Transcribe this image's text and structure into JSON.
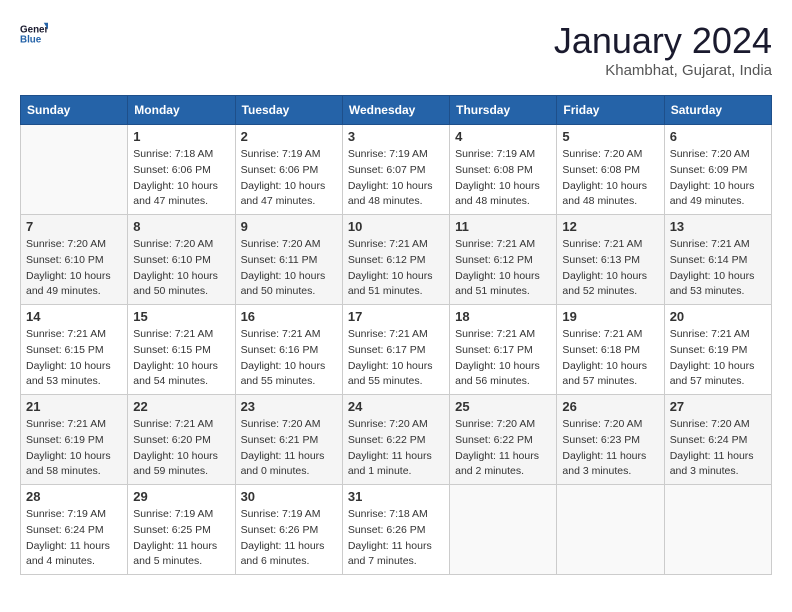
{
  "header": {
    "logo_line1": "General",
    "logo_line2": "Blue",
    "month": "January 2024",
    "location": "Khambhat, Gujarat, India"
  },
  "weekdays": [
    "Sunday",
    "Monday",
    "Tuesday",
    "Wednesday",
    "Thursday",
    "Friday",
    "Saturday"
  ],
  "weeks": [
    [
      {
        "day": "",
        "info": ""
      },
      {
        "day": "1",
        "info": "Sunrise: 7:18 AM\nSunset: 6:06 PM\nDaylight: 10 hours\nand 47 minutes."
      },
      {
        "day": "2",
        "info": "Sunrise: 7:19 AM\nSunset: 6:06 PM\nDaylight: 10 hours\nand 47 minutes."
      },
      {
        "day": "3",
        "info": "Sunrise: 7:19 AM\nSunset: 6:07 PM\nDaylight: 10 hours\nand 48 minutes."
      },
      {
        "day": "4",
        "info": "Sunrise: 7:19 AM\nSunset: 6:08 PM\nDaylight: 10 hours\nand 48 minutes."
      },
      {
        "day": "5",
        "info": "Sunrise: 7:20 AM\nSunset: 6:08 PM\nDaylight: 10 hours\nand 48 minutes."
      },
      {
        "day": "6",
        "info": "Sunrise: 7:20 AM\nSunset: 6:09 PM\nDaylight: 10 hours\nand 49 minutes."
      }
    ],
    [
      {
        "day": "7",
        "info": "Sunrise: 7:20 AM\nSunset: 6:10 PM\nDaylight: 10 hours\nand 49 minutes."
      },
      {
        "day": "8",
        "info": "Sunrise: 7:20 AM\nSunset: 6:10 PM\nDaylight: 10 hours\nand 50 minutes."
      },
      {
        "day": "9",
        "info": "Sunrise: 7:20 AM\nSunset: 6:11 PM\nDaylight: 10 hours\nand 50 minutes."
      },
      {
        "day": "10",
        "info": "Sunrise: 7:21 AM\nSunset: 6:12 PM\nDaylight: 10 hours\nand 51 minutes."
      },
      {
        "day": "11",
        "info": "Sunrise: 7:21 AM\nSunset: 6:12 PM\nDaylight: 10 hours\nand 51 minutes."
      },
      {
        "day": "12",
        "info": "Sunrise: 7:21 AM\nSunset: 6:13 PM\nDaylight: 10 hours\nand 52 minutes."
      },
      {
        "day": "13",
        "info": "Sunrise: 7:21 AM\nSunset: 6:14 PM\nDaylight: 10 hours\nand 53 minutes."
      }
    ],
    [
      {
        "day": "14",
        "info": "Sunrise: 7:21 AM\nSunset: 6:15 PM\nDaylight: 10 hours\nand 53 minutes."
      },
      {
        "day": "15",
        "info": "Sunrise: 7:21 AM\nSunset: 6:15 PM\nDaylight: 10 hours\nand 54 minutes."
      },
      {
        "day": "16",
        "info": "Sunrise: 7:21 AM\nSunset: 6:16 PM\nDaylight: 10 hours\nand 55 minutes."
      },
      {
        "day": "17",
        "info": "Sunrise: 7:21 AM\nSunset: 6:17 PM\nDaylight: 10 hours\nand 55 minutes."
      },
      {
        "day": "18",
        "info": "Sunrise: 7:21 AM\nSunset: 6:17 PM\nDaylight: 10 hours\nand 56 minutes."
      },
      {
        "day": "19",
        "info": "Sunrise: 7:21 AM\nSunset: 6:18 PM\nDaylight: 10 hours\nand 57 minutes."
      },
      {
        "day": "20",
        "info": "Sunrise: 7:21 AM\nSunset: 6:19 PM\nDaylight: 10 hours\nand 57 minutes."
      }
    ],
    [
      {
        "day": "21",
        "info": "Sunrise: 7:21 AM\nSunset: 6:19 PM\nDaylight: 10 hours\nand 58 minutes."
      },
      {
        "day": "22",
        "info": "Sunrise: 7:21 AM\nSunset: 6:20 PM\nDaylight: 10 hours\nand 59 minutes."
      },
      {
        "day": "23",
        "info": "Sunrise: 7:20 AM\nSunset: 6:21 PM\nDaylight: 11 hours\nand 0 minutes."
      },
      {
        "day": "24",
        "info": "Sunrise: 7:20 AM\nSunset: 6:22 PM\nDaylight: 11 hours\nand 1 minute."
      },
      {
        "day": "25",
        "info": "Sunrise: 7:20 AM\nSunset: 6:22 PM\nDaylight: 11 hours\nand 2 minutes."
      },
      {
        "day": "26",
        "info": "Sunrise: 7:20 AM\nSunset: 6:23 PM\nDaylight: 11 hours\nand 3 minutes."
      },
      {
        "day": "27",
        "info": "Sunrise: 7:20 AM\nSunset: 6:24 PM\nDaylight: 11 hours\nand 3 minutes."
      }
    ],
    [
      {
        "day": "28",
        "info": "Sunrise: 7:19 AM\nSunset: 6:24 PM\nDaylight: 11 hours\nand 4 minutes."
      },
      {
        "day": "29",
        "info": "Sunrise: 7:19 AM\nSunset: 6:25 PM\nDaylight: 11 hours\nand 5 minutes."
      },
      {
        "day": "30",
        "info": "Sunrise: 7:19 AM\nSunset: 6:26 PM\nDaylight: 11 hours\nand 6 minutes."
      },
      {
        "day": "31",
        "info": "Sunrise: 7:18 AM\nSunset: 6:26 PM\nDaylight: 11 hours\nand 7 minutes."
      },
      {
        "day": "",
        "info": ""
      },
      {
        "day": "",
        "info": ""
      },
      {
        "day": "",
        "info": ""
      }
    ]
  ]
}
